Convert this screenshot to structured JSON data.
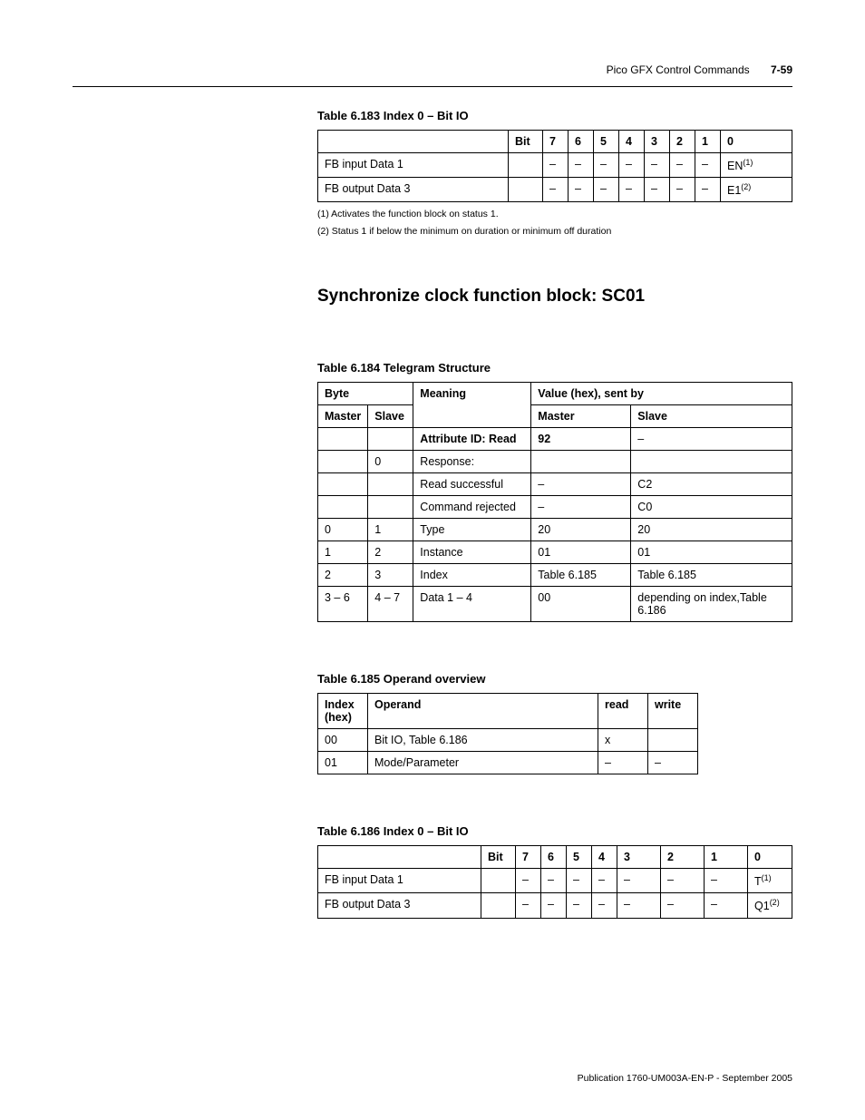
{
  "header": {
    "title": "Pico GFX Control Commands",
    "pagenum": "7-59"
  },
  "table183": {
    "caption": "Table 6.183 Index 0 – Bit IO",
    "headers": {
      "blank": "",
      "bit": "Bit",
      "b7": "7",
      "b6": "6",
      "b5": "5",
      "b4": "4",
      "b3": "3",
      "b2": "2",
      "b1": "1",
      "b0": "0"
    },
    "rows": [
      {
        "label": "FB input Data 1",
        "bit": "",
        "c7": "–",
        "c6": "–",
        "c5": "–",
        "c4": "–",
        "c3": "–",
        "c2": "–",
        "c1": "–",
        "c0": "EN",
        "sup": "(1)"
      },
      {
        "label": "FB output Data 3",
        "bit": "",
        "c7": "–",
        "c6": "–",
        "c5": "–",
        "c4": "–",
        "c3": "–",
        "c2": "–",
        "c1": "–",
        "c0": "E1",
        "sup": "(2)"
      }
    ],
    "footnotes": [
      "(1)  Activates the function block on status 1.",
      "(2)  Status 1 if below the minimum on duration or minimum off duration"
    ]
  },
  "section_title": "Synchronize clock function block: SC01",
  "table184": {
    "caption": "Table 6.184 Telegram Structure",
    "headers": {
      "byte": "Byte",
      "master": "Master",
      "slave": "Slave",
      "meaning": "Meaning",
      "value": "Value (hex), sent by"
    },
    "rows": [
      {
        "master": "",
        "slave": "",
        "meaning": "Attribute ID: Read",
        "vmaster": "92",
        "vslave": "–",
        "bold": true
      },
      {
        "master": "",
        "slave": "0",
        "meaning": "Response:",
        "vmaster": "",
        "vslave": ""
      },
      {
        "master": "",
        "slave": "",
        "meaning": "Read successful",
        "vmaster": "–",
        "vslave": "C2"
      },
      {
        "master": "",
        "slave": "",
        "meaning": "Command rejected",
        "vmaster": "–",
        "vslave": "C0"
      },
      {
        "master": "0",
        "slave": "1",
        "meaning": "Type",
        "vmaster": "20",
        "vslave": "20"
      },
      {
        "master": "1",
        "slave": "2",
        "meaning": "Instance",
        "vmaster": "01",
        "vslave": "01"
      },
      {
        "master": "2",
        "slave": "3",
        "meaning": "Index",
        "vmaster": "Table 6.185",
        "vslave": "Table 6.185"
      },
      {
        "master": "3 – 6",
        "slave": "4 – 7",
        "meaning": "Data 1 – 4",
        "vmaster": "00",
        "vslave": "depending on index,Table 6.186"
      }
    ]
  },
  "table185": {
    "caption": "Table 6.185 Operand overview",
    "headers": {
      "index": "Index (hex)",
      "operand": "Operand",
      "read": "read",
      "write": "write"
    },
    "rows": [
      {
        "index": "00",
        "operand": "Bit IO, Table 6.186",
        "read": "x",
        "write": ""
      },
      {
        "index": "01",
        "operand": "Mode/Parameter",
        "read": "–",
        "write": "–"
      }
    ]
  },
  "table186": {
    "caption": "Table 6.186 Index 0 – Bit IO",
    "headers": {
      "blank": "",
      "bit": "Bit",
      "b7": "7",
      "b6": "6",
      "b5": "5",
      "b4": "4",
      "b3": "3",
      "b2": "2",
      "b1": "1",
      "b0": "0"
    },
    "rows": [
      {
        "label": "FB input Data 1",
        "bit": "",
        "c7": "–",
        "c6": "–",
        "c5": "–",
        "c4": "–",
        "c3": "–",
        "c2": "–",
        "c1": "–",
        "c0": "T",
        "sup": "(1)"
      },
      {
        "label": "FB output Data 3",
        "bit": "",
        "c7": "–",
        "c6": "–",
        "c5": "–",
        "c4": "–",
        "c3": "–",
        "c2": "–",
        "c1": "–",
        "c0": "Q1",
        "sup": "(2)"
      }
    ]
  },
  "publication": "Publication 1760-UM003A-EN-P - September 2005"
}
